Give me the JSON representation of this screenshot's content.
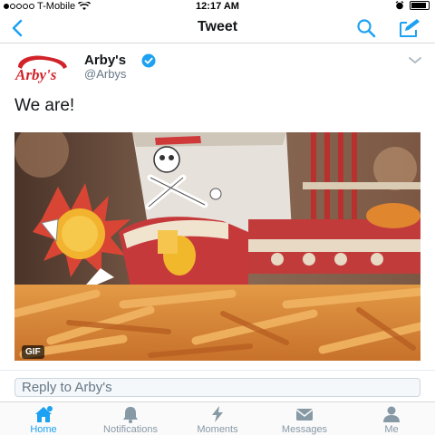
{
  "status_bar": {
    "carrier": "T-Mobile",
    "time": "12:17 AM",
    "battery_level": 0.9
  },
  "nav": {
    "title": "Tweet",
    "back_icon": "back-chevron-icon",
    "search_icon": "search-icon",
    "compose_icon": "compose-icon"
  },
  "tweet": {
    "logo_text": "Arby's",
    "user_name": "Arby's",
    "handle": "@Arbys",
    "verified": true,
    "text": "We are!",
    "media_type_label": "GIF"
  },
  "reply": {
    "placeholder": "Reply to Arby's"
  },
  "tabs": [
    {
      "label": "Home",
      "icon": "home-icon",
      "active": true
    },
    {
      "label": "Notifications",
      "icon": "bell-icon",
      "active": false
    },
    {
      "label": "Moments",
      "icon": "lightning-icon",
      "active": false
    },
    {
      "label": "Messages",
      "icon": "envelope-icon",
      "active": false
    },
    {
      "label": "Me",
      "icon": "person-icon",
      "active": false
    }
  ],
  "colors": {
    "accent": "#1da1f2",
    "brand_red": "#d2232a",
    "muted": "#8899a6"
  }
}
